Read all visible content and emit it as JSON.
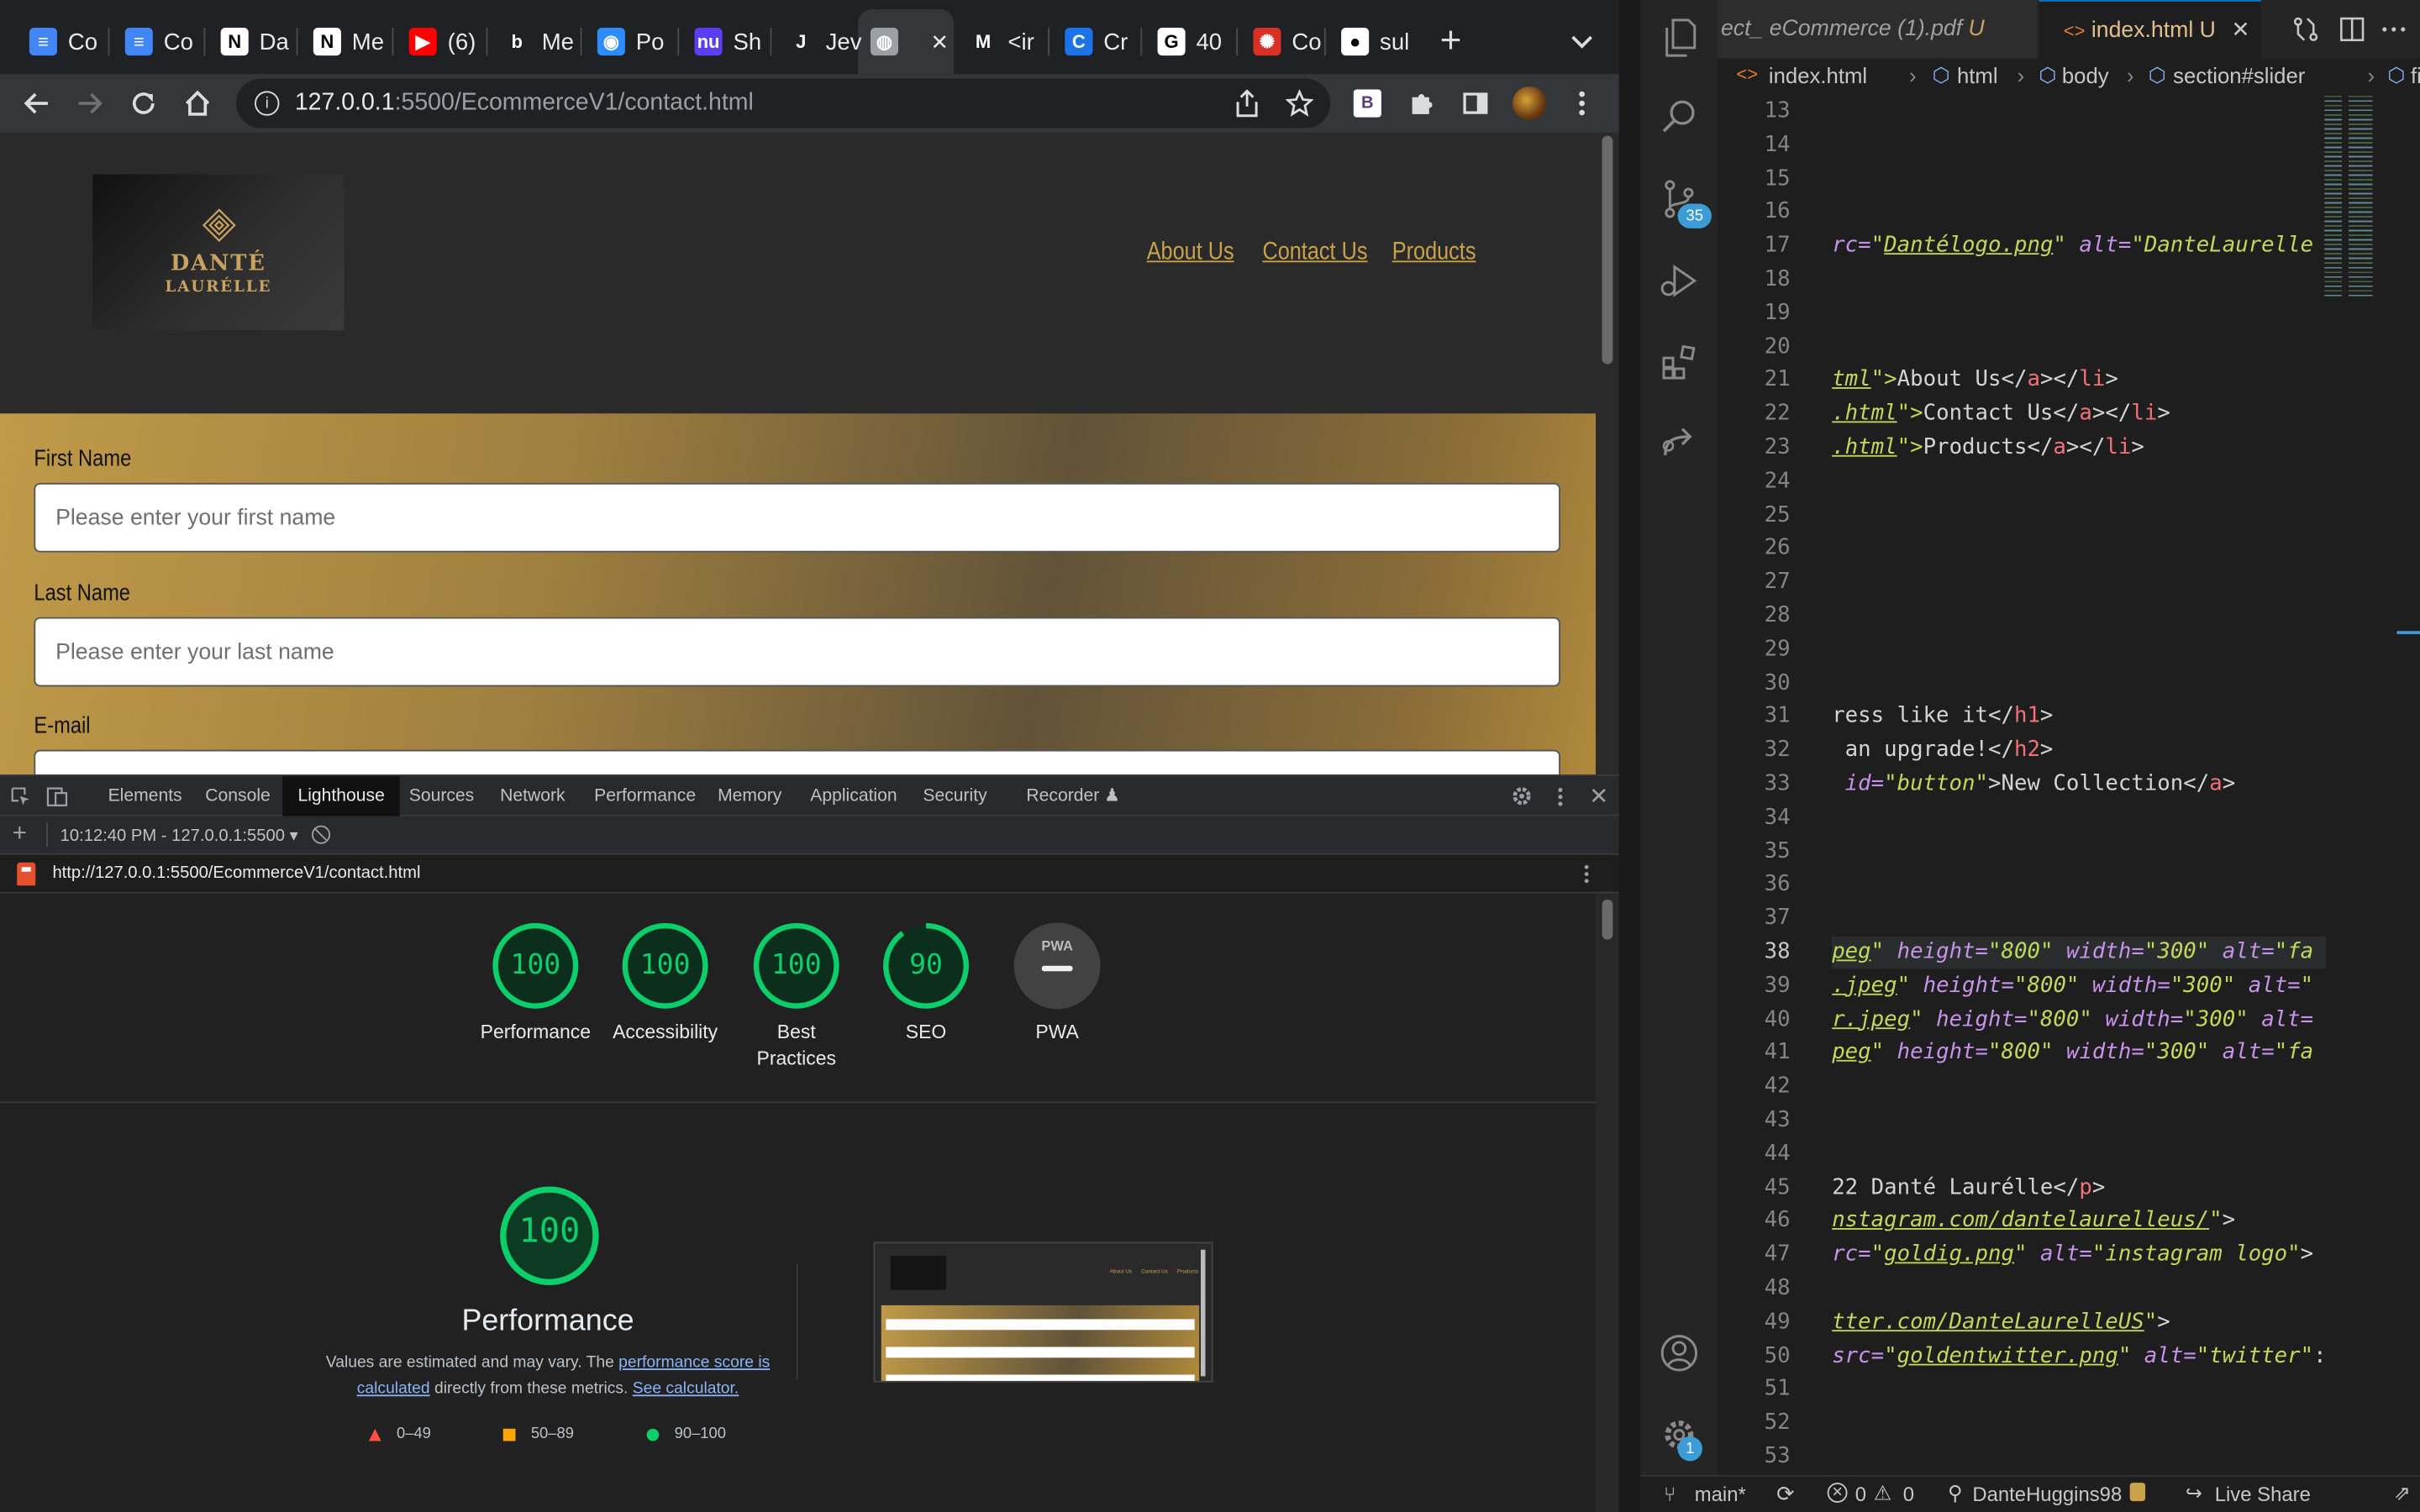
{
  "browser": {
    "tabs": [
      {
        "label": "Co",
        "icon": "google-docs-icon"
      },
      {
        "label": "Co",
        "icon": "google-docs-icon"
      },
      {
        "label": "Da",
        "icon": "notion-icon"
      },
      {
        "label": "Me",
        "icon": "notion-icon"
      },
      {
        "label": "(6)",
        "icon": "youtube-icon"
      },
      {
        "label": "Me",
        "icon": "b-icon"
      },
      {
        "label": "Po",
        "icon": "zoom-icon"
      },
      {
        "label": "Sh",
        "icon": "nu-icon"
      },
      {
        "label": "Jev",
        "icon": "jw-icon"
      },
      {
        "label": "",
        "icon": "globe-icon",
        "active": true
      },
      {
        "label": "<ir",
        "icon": "m-icon"
      },
      {
        "label": "Cr",
        "icon": "c-icon"
      },
      {
        "label": "40",
        "icon": "google-icon"
      },
      {
        "label": "Co",
        "icon": "red-app-icon"
      },
      {
        "label": "sul",
        "icon": "github-icon"
      }
    ],
    "url_host": "127.0.0.1",
    "url_path": ":5500/EcommerceV1/contact.html"
  },
  "site": {
    "logo_name": "DANTÉ",
    "logo_sub": "LAURÉLLE",
    "nav": [
      "About Us",
      "Contact Us",
      "Products"
    ],
    "fields": [
      {
        "label": "First Name",
        "placeholder": "Please enter your first name"
      },
      {
        "label": "Last Name",
        "placeholder": "Please enter your last name"
      },
      {
        "label": "E-mail",
        "placeholder": ""
      }
    ]
  },
  "devtools": {
    "tabs": [
      "Elements",
      "Console",
      "Lighthouse",
      "Sources",
      "Network",
      "Performance",
      "Memory",
      "Application",
      "Security",
      "Recorder"
    ],
    "active_tab": "Lighthouse",
    "report_select": "10:12:40 PM - 127.0.0.1:5500",
    "report_url": "http://127.0.0.1:5500/EcommerceV1/contact.html",
    "scores": [
      {
        "label": "Performance",
        "value": "100",
        "fraction": 1.0
      },
      {
        "label": "Accessibility",
        "value": "100",
        "fraction": 1.0
      },
      {
        "label": "Best Practices",
        "value": "100",
        "fraction": 1.0
      },
      {
        "label": "SEO",
        "value": "90",
        "fraction": 0.9
      },
      {
        "label": "PWA",
        "value": "PWA",
        "fraction": 0
      }
    ],
    "big_score": "100",
    "big_title": "Performance",
    "desc_prefix": "Values are estimated and may vary. The ",
    "desc_link1": "performance score is calculated",
    "desc_mid": " directly from these metrics. ",
    "desc_link2": "See calculator.",
    "legend": [
      {
        "range": "0–49",
        "color": "#ff4e42"
      },
      {
        "range": "50–89",
        "color": "#ffa400"
      },
      {
        "range": "90–100",
        "color": "#0cce6b"
      }
    ],
    "thumb_nav": [
      "About Us",
      "Contact Us",
      "Products"
    ]
  },
  "vscode": {
    "tab_pdf": "ect_ eCommerce (1).pdf",
    "tab_pdf_badge": "U",
    "tab_html": "index.html",
    "tab_html_badge": "U",
    "breadcrumb": [
      "index.html",
      "html",
      "body",
      "section#slider",
      "figure"
    ],
    "scm_badge": "35",
    "settings_badge": "1",
    "lines": [
      {
        "n": "13",
        "code": []
      },
      {
        "n": "14",
        "code": []
      },
      {
        "n": "15",
        "code": []
      },
      {
        "n": "16",
        "code": []
      },
      {
        "n": "17",
        "code": [
          [
            "rc=",
            "attr"
          ],
          [
            "\"",
            "str"
          ],
          [
            "Dantélogo.png",
            "strul"
          ],
          [
            "\"",
            "str"
          ],
          [
            " alt=",
            "attr"
          ],
          [
            "\"DanteLaurelle",
            "str"
          ]
        ]
      },
      {
        "n": "18",
        "code": []
      },
      {
        "n": "19",
        "code": []
      },
      {
        "n": "20",
        "code": []
      },
      {
        "n": "21",
        "code": [
          [
            "tml",
            "strul"
          ],
          [
            "\">",
            "str"
          ],
          [
            "About Us",
            "txt"
          ],
          [
            "</",
            "punc"
          ],
          [
            "a",
            "tag"
          ],
          [
            "></",
            "punc"
          ],
          [
            "li",
            "tag"
          ],
          [
            ">",
            "punc"
          ]
        ]
      },
      {
        "n": "22",
        "code": [
          [
            ".html",
            "strul"
          ],
          [
            "\">",
            "str"
          ],
          [
            "Contact Us",
            "txt"
          ],
          [
            "</",
            "punc"
          ],
          [
            "a",
            "tag"
          ],
          [
            "></",
            "punc"
          ],
          [
            "li",
            "tag"
          ],
          [
            ">",
            "punc"
          ]
        ]
      },
      {
        "n": "23",
        "code": [
          [
            ".html",
            "strul"
          ],
          [
            "\">",
            "str"
          ],
          [
            "Products",
            "txt"
          ],
          [
            "</",
            "punc"
          ],
          [
            "a",
            "tag"
          ],
          [
            "></",
            "punc"
          ],
          [
            "li",
            "tag"
          ],
          [
            ">",
            "punc"
          ]
        ]
      },
      {
        "n": "24",
        "code": []
      },
      {
        "n": "25",
        "code": []
      },
      {
        "n": "26",
        "code": []
      },
      {
        "n": "27",
        "code": []
      },
      {
        "n": "28",
        "code": []
      },
      {
        "n": "29",
        "code": []
      },
      {
        "n": "30",
        "code": []
      },
      {
        "n": "31",
        "code": [
          [
            "ress like it",
            "txt"
          ],
          [
            "</",
            "punc"
          ],
          [
            "h1",
            "tag"
          ],
          [
            ">",
            "punc"
          ]
        ]
      },
      {
        "n": "32",
        "code": [
          [
            " an upgrade!",
            "txt"
          ],
          [
            "</",
            "punc"
          ],
          [
            "h2",
            "tag"
          ],
          [
            ">",
            "punc"
          ]
        ]
      },
      {
        "n": "33",
        "code": [
          [
            " id=",
            "attr"
          ],
          [
            "\"button\"",
            "str"
          ],
          [
            ">",
            "punc"
          ],
          [
            "New Collection",
            "txt"
          ],
          [
            "</",
            "punc"
          ],
          [
            "a",
            "tag"
          ],
          [
            ">",
            "punc"
          ]
        ]
      },
      {
        "n": "34",
        "code": []
      },
      {
        "n": "35",
        "code": []
      },
      {
        "n": "36",
        "code": []
      },
      {
        "n": "37",
        "code": []
      },
      {
        "n": "38",
        "code": [
          [
            "peg",
            "strul"
          ],
          [
            "\"",
            "str"
          ],
          [
            " height=",
            "attr"
          ],
          [
            "\"800\"",
            "str"
          ],
          [
            " width=",
            "attr"
          ],
          [
            "\"300\"",
            "str"
          ],
          [
            " alt=",
            "attr"
          ],
          [
            "\"fa",
            "str"
          ]
        ],
        "current": true
      },
      {
        "n": "39",
        "code": [
          [
            ".jpeg",
            "strul"
          ],
          [
            "\"",
            "str"
          ],
          [
            " height=",
            "attr"
          ],
          [
            "\"800\"",
            "str"
          ],
          [
            " width=",
            "attr"
          ],
          [
            "\"300\"",
            "str"
          ],
          [
            " alt=",
            "attr"
          ],
          [
            "\"",
            "str"
          ]
        ]
      },
      {
        "n": "40",
        "code": [
          [
            "r.jpeg",
            "strul"
          ],
          [
            "\"",
            "str"
          ],
          [
            " height=",
            "attr"
          ],
          [
            "\"800\"",
            "str"
          ],
          [
            " width=",
            "attr"
          ],
          [
            "\"300\"",
            "str"
          ],
          [
            " alt=",
            "attr"
          ]
        ]
      },
      {
        "n": "41",
        "code": [
          [
            "peg",
            "strul"
          ],
          [
            "\"",
            "str"
          ],
          [
            " height=",
            "attr"
          ],
          [
            "\"800\"",
            "str"
          ],
          [
            " width=",
            "attr"
          ],
          [
            "\"300\"",
            "str"
          ],
          [
            " alt=",
            "attr"
          ],
          [
            "\"fa",
            "str"
          ]
        ]
      },
      {
        "n": "42",
        "code": []
      },
      {
        "n": "43",
        "code": []
      },
      {
        "n": "44",
        "code": []
      },
      {
        "n": "45",
        "code": [
          [
            "22 Danté Laurélle",
            "txt"
          ],
          [
            "</",
            "punc"
          ],
          [
            "p",
            "tag"
          ],
          [
            ">",
            "punc"
          ]
        ]
      },
      {
        "n": "46",
        "code": [
          [
            "nstagram.com/dantelaurelleus/",
            "strul"
          ],
          [
            "\"",
            "str"
          ],
          [
            ">",
            "punc"
          ]
        ]
      },
      {
        "n": "47",
        "code": [
          [
            "rc=",
            "attr"
          ],
          [
            "\"",
            "str"
          ],
          [
            "goldig.png",
            "strul"
          ],
          [
            "\"",
            "str"
          ],
          [
            " alt=",
            "attr"
          ],
          [
            "\"instagram logo\"",
            "str"
          ],
          [
            ">",
            "punc"
          ]
        ]
      },
      {
        "n": "48",
        "code": []
      },
      {
        "n": "49",
        "code": [
          [
            "tter.com/DanteLaurelleUS",
            "strul"
          ],
          [
            "\"",
            "str"
          ],
          [
            ">",
            "punc"
          ]
        ]
      },
      {
        "n": "50",
        "code": [
          [
            "src=",
            "attr"
          ],
          [
            "\"",
            "str"
          ],
          [
            "goldentwitter.png",
            "strul"
          ],
          [
            "\"",
            "str"
          ],
          [
            " alt=",
            "attr"
          ],
          [
            "\"twitter\"",
            "str"
          ],
          [
            ":",
            "punc"
          ]
        ]
      },
      {
        "n": "51",
        "code": []
      },
      {
        "n": "52",
        "code": []
      },
      {
        "n": "53",
        "code": []
      }
    ],
    "status": {
      "branch": "main*",
      "errors": "0",
      "warnings": "0",
      "user": "DanteHuggins98",
      "live_share": "Live Share"
    }
  }
}
